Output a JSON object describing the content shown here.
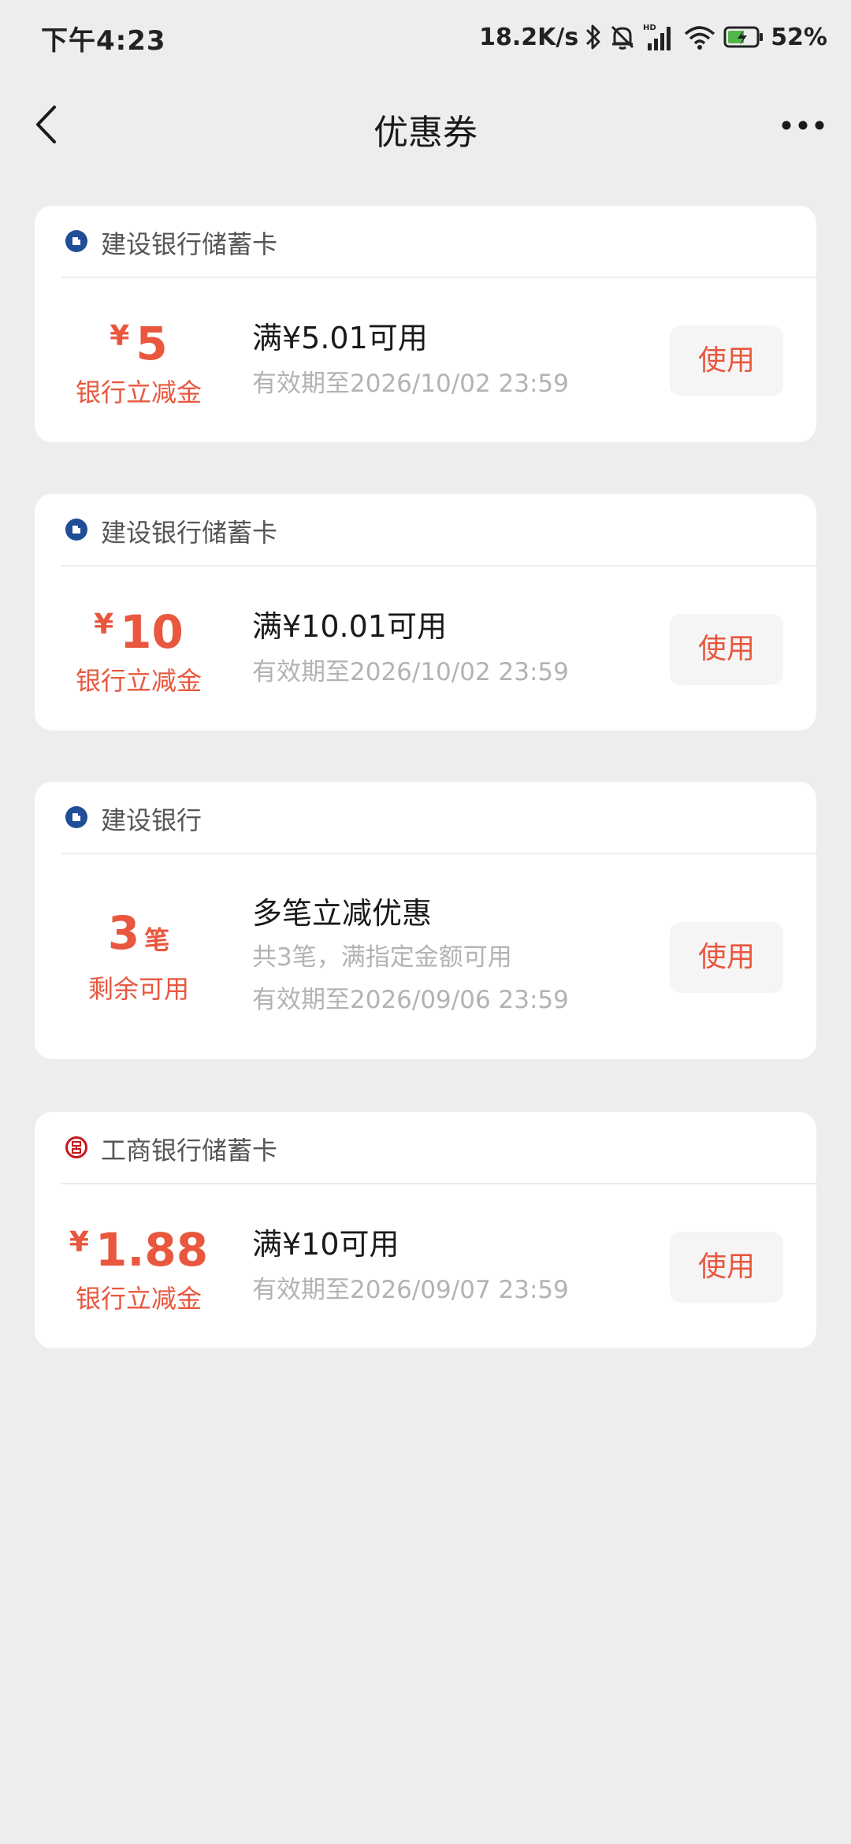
{
  "status_bar": {
    "time": "下午4:23",
    "network_speed": "18.2K/s",
    "battery": "52%",
    "icons": [
      "bluetooth-icon",
      "mute-icon",
      "hd-signal-icon",
      "wifi-icon",
      "battery-charging-icon"
    ]
  },
  "nav": {
    "title": "优惠券",
    "back_icon": "chevron-left-icon",
    "more_icon": "more-dots-icon"
  },
  "coupons": [
    {
      "bank": "建设银行储蓄卡",
      "logo": "ccb-logo",
      "currency": "¥",
      "amount": "5",
      "amount_label": "银行立减金",
      "title": "满¥5.01可用",
      "lines": [
        "有效期至2026/10/02 23:59"
      ],
      "button": "使用"
    },
    {
      "bank": "建设银行储蓄卡",
      "logo": "ccb-logo",
      "currency": "¥",
      "amount": "10",
      "amount_label": "银行立减金",
      "title": "满¥10.01可用",
      "lines": [
        "有效期至2026/10/02 23:59"
      ],
      "button": "使用"
    },
    {
      "bank": "建设银行",
      "logo": "ccb-logo",
      "amount": "3",
      "amount_unit": "笔",
      "amount_label": "剩余可用",
      "title": "多笔立减优惠",
      "lines": [
        "共3笔，满指定金额可用",
        "有效期至2026/09/06 23:59"
      ],
      "button": "使用"
    },
    {
      "bank": "工商银行储蓄卡",
      "logo": "icbc-logo",
      "currency": "¥",
      "amount": "1.88",
      "amount_label": "银行立减金",
      "title": "满¥10可用",
      "lines": [
        "有效期至2026/09/07 23:59"
      ],
      "button": "使用"
    }
  ],
  "colors": {
    "accent": "#e8573e",
    "background": "#ededed",
    "card": "#ffffff",
    "muted_text": "#b3b3b3",
    "ccb_blue": "#1f4e96",
    "icbc_red": "#c7161e"
  }
}
